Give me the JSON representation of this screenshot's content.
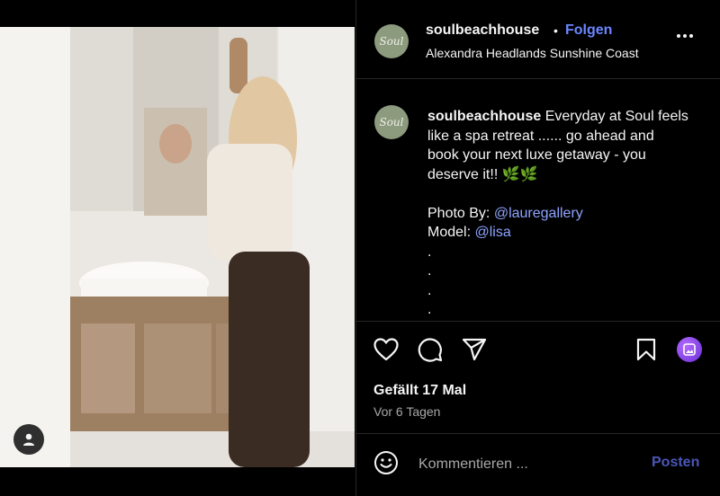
{
  "post": {
    "username": "soulbeachhouse",
    "follow_label": "Folgen",
    "separator": "•",
    "location": "Alexandra Headlands Sunshine Coast",
    "avatar_text": "Soul"
  },
  "caption": {
    "username": "soulbeachhouse",
    "line1": " Everyday at Soul feels",
    "line2": "like a spa retreat ...... go ahead and",
    "line3": "book your next luxe getaway - you",
    "line4": "deserve it!! 🌿🌿",
    "photo_label": "Photo By: ",
    "photo_link": "@lauregallery",
    "model_label": "Model: ",
    "model_link": "@lisa",
    "dots": [
      ".",
      ".",
      ".",
      "."
    ]
  },
  "engagement": {
    "likes": "Gefällt 17 Mal",
    "time_ago": "Vor 6 Tagen"
  },
  "comment": {
    "placeholder": "Kommentieren ...",
    "post_label": "Posten"
  },
  "icons": [
    "heart-icon",
    "comment-icon",
    "share-icon",
    "bookmark-icon",
    "emoji-icon",
    "more-icon",
    "user-tag-icon"
  ],
  "colors": {
    "accent": "#6b87ff",
    "link": "#8ea4ff",
    "post": "#4a56b8",
    "muted": "#a8a8a8"
  }
}
